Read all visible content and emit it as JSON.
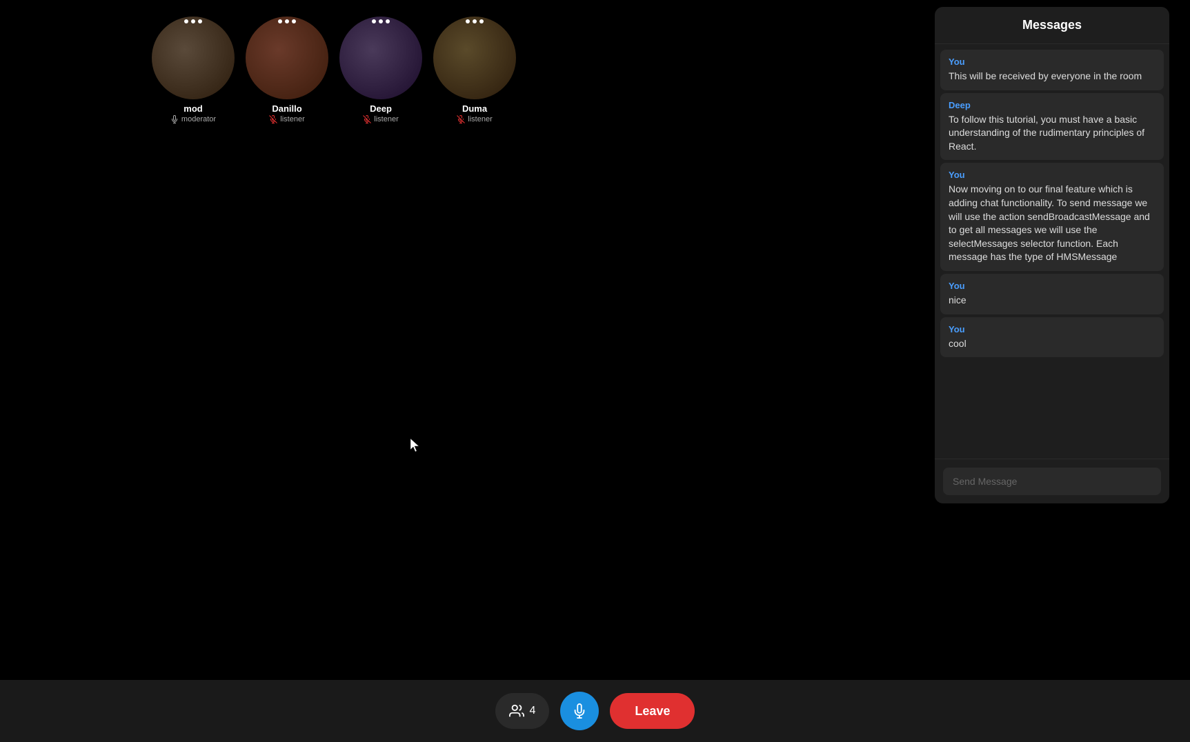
{
  "header": {
    "title": "Messages"
  },
  "participants": [
    {
      "id": "mod",
      "name": "mod",
      "role": "moderator",
      "muted": false,
      "avatarClass": "avatar-mod"
    },
    {
      "id": "danillo",
      "name": "Danillo",
      "role": "listener",
      "muted": true,
      "avatarClass": "avatar-danillo"
    },
    {
      "id": "deep",
      "name": "Deep",
      "role": "listener",
      "muted": true,
      "avatarClass": "avatar-deep"
    },
    {
      "id": "duma",
      "name": "Duma",
      "role": "listener",
      "muted": true,
      "avatarClass": "avatar-duma"
    }
  ],
  "messages": [
    {
      "sender": "You",
      "senderClass": "sender-you",
      "text": "This will be received by everyone in the room"
    },
    {
      "sender": "Deep",
      "senderClass": "sender-deep",
      "text": "To follow this tutorial, you must have a basic understanding of the rudimentary principles of React."
    },
    {
      "sender": "You",
      "senderClass": "sender-you",
      "text": "Now moving on to our final feature which is adding chat functionality. To send message we will use the action sendBroadcastMessage and to get all messages we will use the selectMessages selector function. Each message has the type of HMSMessage"
    },
    {
      "sender": "You",
      "senderClass": "sender-you",
      "text": "nice"
    },
    {
      "sender": "You",
      "senderClass": "sender-you",
      "text": "cool"
    }
  ],
  "input": {
    "placeholder": "Send Message"
  },
  "bottomBar": {
    "participantsCount": "4",
    "leaveLabel": "Leave"
  }
}
